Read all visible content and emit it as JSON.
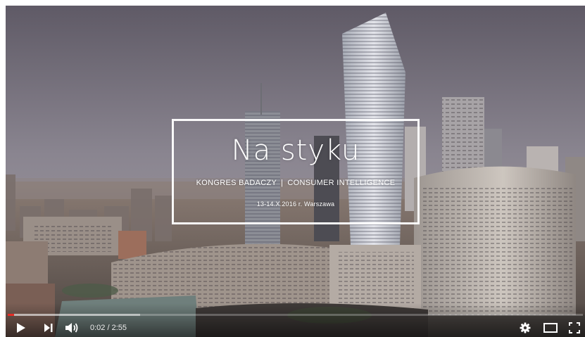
{
  "video": {
    "title_main": "Na styku",
    "subtitle_left": "KONGRES BADACZY",
    "subtitle_sep": "|",
    "subtitle_right": "CONSUMER INTELLIGENCE",
    "date_line": "13-14.X.2016 r. Warszawa",
    "scene": "warsaw-skyline-frame"
  },
  "player": {
    "current_time": "0:02",
    "time_sep": " / ",
    "duration": "2:55",
    "progress": {
      "played_fraction": 0.011,
      "loaded_fraction": 0.23
    },
    "accent_color": "#e52d27",
    "icons": {
      "play": "play-icon",
      "next": "next-icon",
      "volume": "volume-icon",
      "settings": "gear-icon",
      "theater": "theater-mode-icon",
      "fullscreen": "fullscreen-icon"
    }
  }
}
